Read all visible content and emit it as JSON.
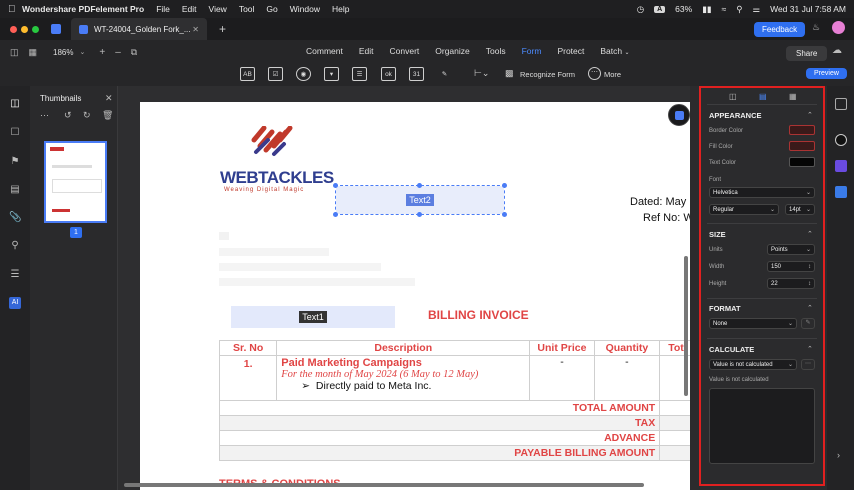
{
  "menubar": {
    "app_name": "Wondershare PDFelement Pro",
    "items": [
      "File",
      "Edit",
      "View",
      "Tool",
      "Go",
      "Window",
      "Help"
    ],
    "kbd": "A",
    "battery": "63%",
    "datetime": "Wed 31 Jul  7:58 AM"
  },
  "tabbar": {
    "doc_title": "WT-24004_Golden Fork_...",
    "feedback": "Feedback"
  },
  "toolbar": {
    "zoom": "186%",
    "nav": [
      "Comment",
      "Edit",
      "Convert",
      "Organize",
      "Tools",
      "Form",
      "Protect",
      "Batch"
    ],
    "share": "Share",
    "form_tools": [
      "AB",
      "☑",
      "◉",
      "▾",
      "☰",
      "ok",
      "31",
      "✎"
    ],
    "recognize": "Recognize Form",
    "more": "More",
    "preview": "Preview"
  },
  "thumbnails": {
    "title": "Thumbnails",
    "page_number": "1"
  },
  "document": {
    "logo_text": "WEBTACKLES",
    "logo_tagline": "Weaving Digital Magic",
    "text2_label": "Text2",
    "text1_label": "Text1",
    "dated": "Dated: May",
    "ref": "Ref No: W",
    "invoice_title": "BILLING INVOICE",
    "table": {
      "headers": [
        "Sr. No",
        "Description",
        "Unit Price",
        "Quantity",
        "Tot"
      ],
      "row": {
        "sr": "1.",
        "desc_title": "Paid Marketing Campaigns",
        "desc_sub": "For the month of May 2024 (6 May to 12 May)",
        "desc_bullet": "Directly paid to Meta Inc.",
        "unit": "-",
        "qty": "-"
      },
      "summary": [
        "TOTAL AMOUNT",
        "TAX",
        "ADVANCE",
        "PAYABLE BILLING AMOUNT"
      ]
    },
    "footer_partial": "TERMS & CONDITIONS"
  },
  "properties": {
    "appearance": {
      "title": "APPEARANCE",
      "border_color": "Border Color",
      "fill_color": "Fill Color",
      "text_color": "Text Color",
      "font": "Font",
      "font_value": "Helvetica",
      "style_value": "Regular",
      "size_value": "14pt"
    },
    "size": {
      "title": "SIZE",
      "units": "Units",
      "units_value": "Points",
      "width": "Width",
      "width_value": "150",
      "height": "Height",
      "height_value": "22"
    },
    "format": {
      "title": "FORMAT",
      "value": "None"
    },
    "calculate": {
      "title": "CALCULATE",
      "value": "Value is not calculated",
      "desc": "Value is not calculated"
    }
  },
  "colors": {
    "accent": "#2f6ff0",
    "highlight_border": "#e02020",
    "invoice_red": "#e04545"
  }
}
